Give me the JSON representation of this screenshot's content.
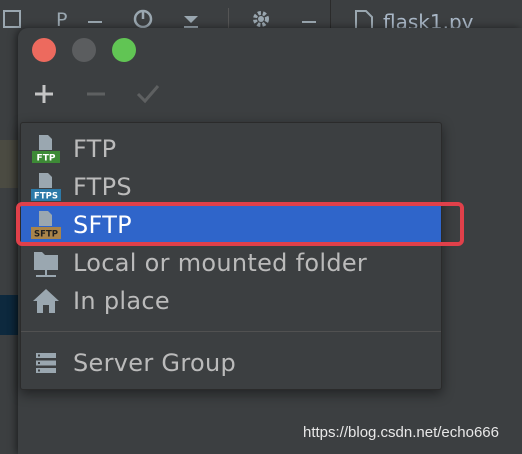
{
  "ide": {
    "tab_title": "flask1.py",
    "toolbar_letter": "P"
  },
  "dialog": {
    "toolbar": {
      "add_icon": "plus-icon",
      "remove_icon": "minus-icon",
      "apply_icon": "check-icon"
    }
  },
  "menu": {
    "items": [
      {
        "label": "FTP",
        "icon": "ftp-icon",
        "badge": "FTP",
        "badge_color": "#3d8a36",
        "selected": false
      },
      {
        "label": "FTPS",
        "icon": "ftps-icon",
        "badge": "FTPS",
        "badge_color": "#2d7aa8",
        "selected": false
      },
      {
        "label": "SFTP",
        "icon": "sftp-icon",
        "badge": "SFTP",
        "badge_color": "#a9844a",
        "selected": true
      },
      {
        "label": "Local or mounted folder",
        "icon": "folder-icon",
        "selected": false
      },
      {
        "label": "In place",
        "icon": "home-icon",
        "selected": false
      },
      {
        "label": "Server Group",
        "icon": "server-group-icon",
        "selected": false
      }
    ]
  },
  "colors": {
    "selection": "#2f65ca",
    "highlight": "#e0404a",
    "background": "#3c3f41"
  },
  "watermark": "https://blog.csdn.net/echo666"
}
